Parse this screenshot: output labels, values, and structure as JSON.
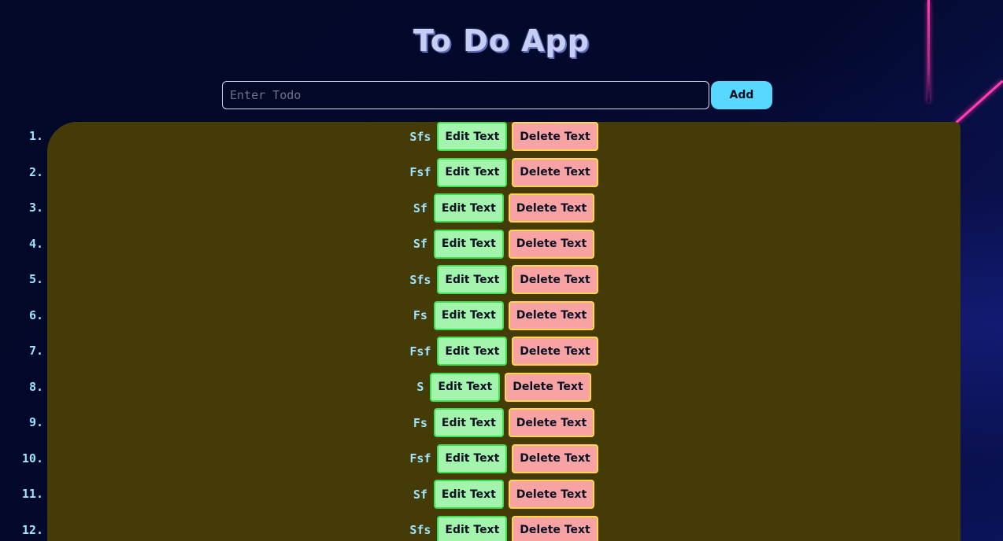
{
  "app": {
    "title": "To Do App"
  },
  "input": {
    "placeholder": "Enter Todo",
    "value": ""
  },
  "add_button": {
    "label": "Add"
  },
  "todos": [
    {
      "number": "1.",
      "text": "Sfs",
      "edit_label": "Edit Text",
      "delete_label": "Delete Text"
    },
    {
      "number": "2.",
      "text": "Fsf",
      "edit_label": "Edit Text",
      "delete_label": "Delete Text"
    },
    {
      "number": "3.",
      "text": "Sf",
      "edit_label": "Edit Text",
      "delete_label": "Delete Text"
    },
    {
      "number": "4.",
      "text": "Sf",
      "edit_label": "Edit Text",
      "delete_label": "Delete Text"
    },
    {
      "number": "5.",
      "text": "Sfs",
      "edit_label": "Edit Text",
      "delete_label": "Delete Text"
    },
    {
      "number": "6.",
      "text": "Fs",
      "edit_label": "Edit Text",
      "delete_label": "Delete Text"
    },
    {
      "number": "7.",
      "text": "Fsf",
      "edit_label": "Edit Text",
      "delete_label": "Delete Text"
    },
    {
      "number": "8.",
      "text": "S",
      "edit_label": "Edit Text",
      "delete_label": "Delete Text"
    },
    {
      "number": "9.",
      "text": "Fs",
      "edit_label": "Edit Text",
      "delete_label": "Delete Text"
    },
    {
      "number": "10.",
      "text": "Fsf",
      "edit_label": "Edit Text",
      "delete_label": "Delete Text"
    },
    {
      "number": "11.",
      "text": "Sf",
      "edit_label": "Edit Text",
      "delete_label": "Delete Text"
    },
    {
      "number": "12.",
      "text": "Sfs",
      "edit_label": "Edit Text",
      "delete_label": "Delete Text"
    }
  ],
  "colors": {
    "background": "#020826",
    "panel": "#453b07",
    "title": "#c7cef5",
    "add_button": "#58d8ff",
    "todo_text": "#9fe3ff",
    "edit_button_bg": "#a3f5ad",
    "edit_button_border": "#3ae24d",
    "delete_button_bg": "#f7a3a3",
    "delete_button_border": "#ffd84a",
    "neon_accent": "#ff3fb0"
  }
}
